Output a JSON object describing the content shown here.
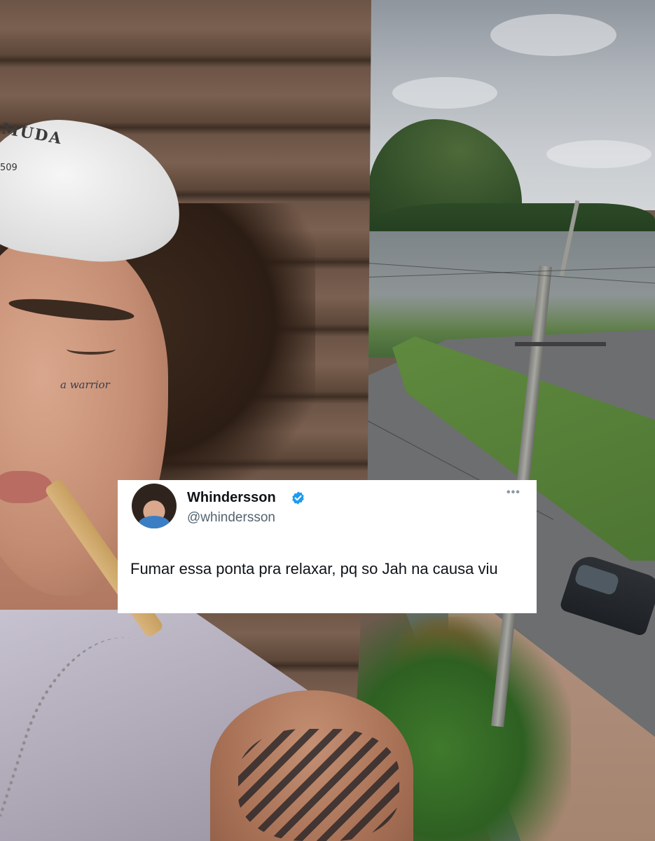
{
  "tweet": {
    "display_name": "Whindersson",
    "handle": "@whindersson",
    "verified": true,
    "text": "Fumar essa ponta pra relaxar, pq so Jah na causa viu",
    "more_icon": "more-horizontal-icon",
    "colors": {
      "verified": "#1d9bf0",
      "name": "#0f1419",
      "handle": "#536471"
    }
  },
  "photo": {
    "cap_text": "MUDA",
    "cap_number": "509",
    "face_tattoo": "a warrior"
  }
}
